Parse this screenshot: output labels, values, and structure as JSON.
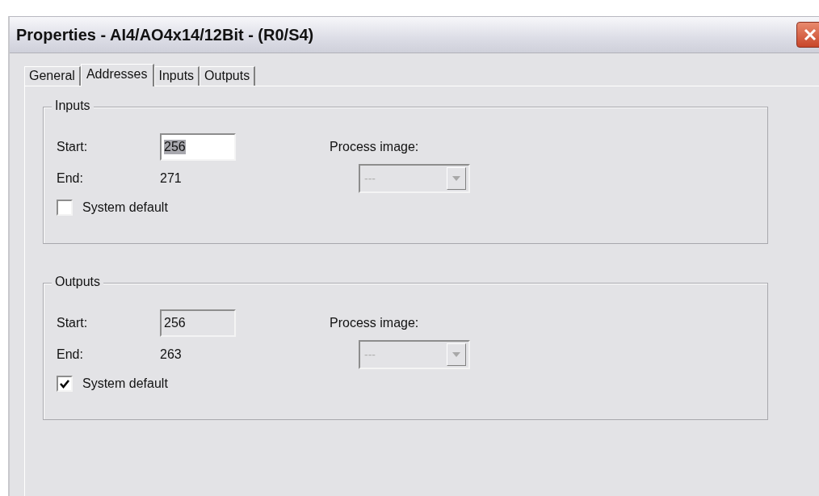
{
  "window": {
    "title": "Properties - AI4/AO4x14/12Bit - (R0/S4)"
  },
  "tabs": [
    {
      "label": "General",
      "selected": false
    },
    {
      "label": "Addresses",
      "selected": true
    },
    {
      "label": "Inputs",
      "selected": false
    },
    {
      "label": "Outputs",
      "selected": false
    }
  ],
  "groups": [
    {
      "title": "Inputs",
      "start_label": "Start:",
      "start_value": "256",
      "start_disabled": false,
      "end_label": "End:",
      "end_value": "271",
      "process_image_label": "Process image:",
      "process_image_value": "---",
      "process_image_disabled": true,
      "system_default": {
        "label": "System default",
        "checked": false
      }
    },
    {
      "title": "Outputs",
      "start_label": "Start:",
      "start_value": "256",
      "start_disabled": true,
      "end_label": "End:",
      "end_value": "263",
      "process_image_label": "Process image:",
      "process_image_value": "---",
      "process_image_disabled": true,
      "system_default": {
        "label": "System default",
        "checked": true
      }
    }
  ]
}
